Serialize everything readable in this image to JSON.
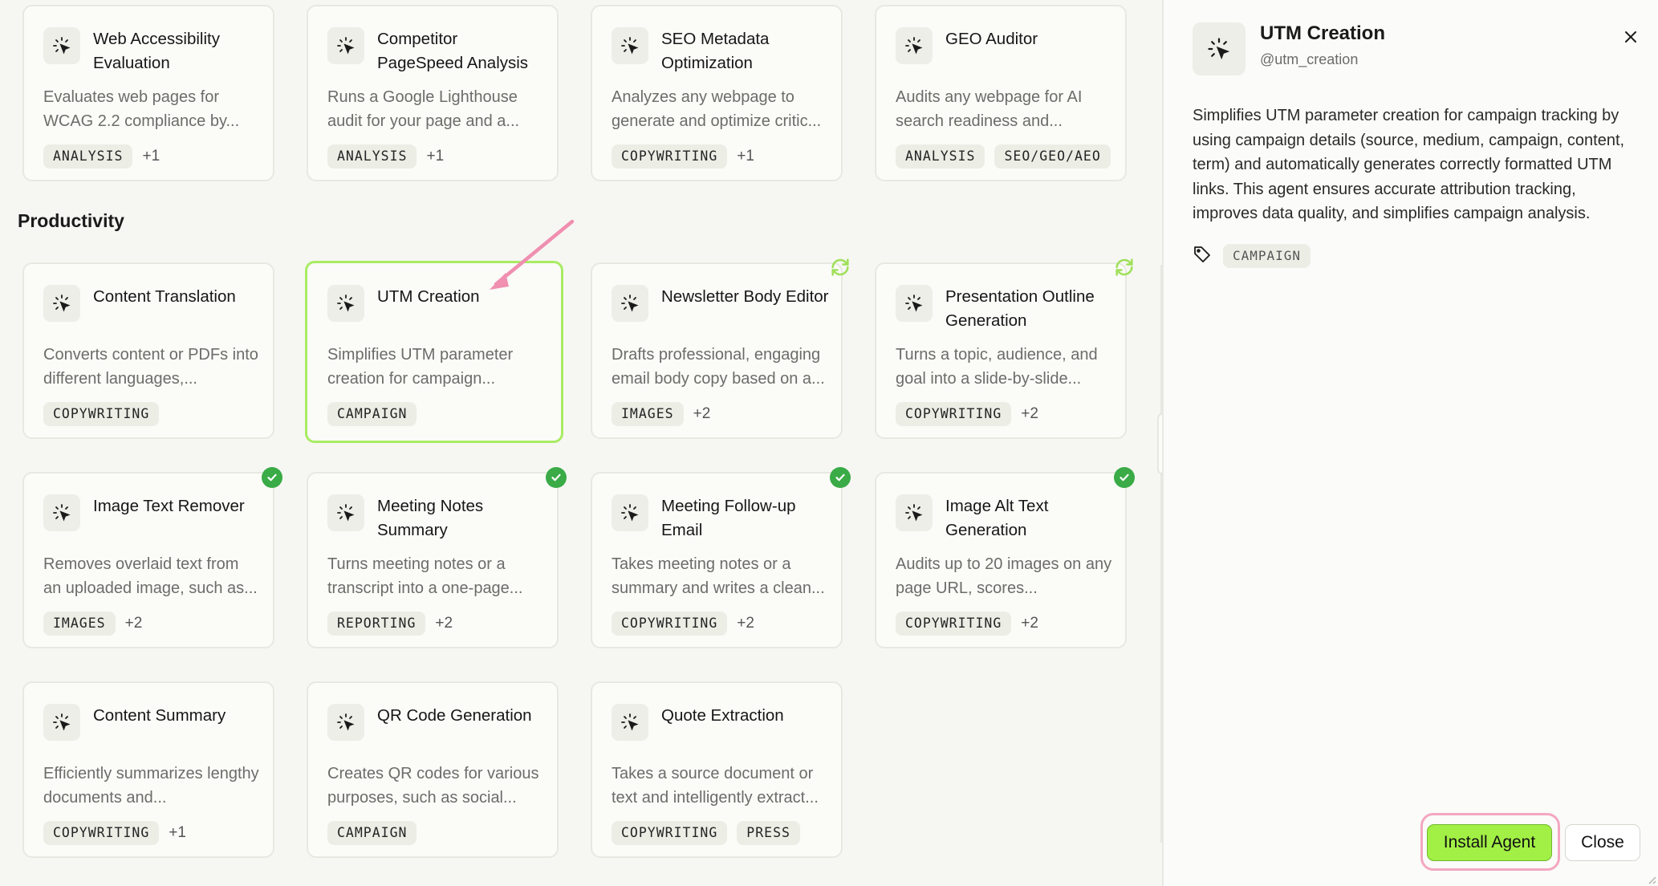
{
  "section": {
    "title": "Productivity"
  },
  "cards": [
    {
      "title": "Web Accessibility Evaluation",
      "desc": "Evaluates web pages for WCAG 2.2 compliance by...",
      "tags": [
        "ANALYSIS"
      ],
      "more": "+1"
    },
    {
      "title": "Competitor PageSpeed Analysis",
      "desc": "Runs a Google Lighthouse audit for your page and a...",
      "tags": [
        "ANALYSIS"
      ],
      "more": "+1"
    },
    {
      "title": "SEO Metadata Optimization",
      "desc": "Analyzes any webpage to generate and optimize critic...",
      "tags": [
        "COPYWRITING"
      ],
      "more": "+1"
    },
    {
      "title": "GEO Auditor",
      "desc": "Audits any webpage for AI search readiness and...",
      "tags": [
        "ANALYSIS",
        "SEO/GEO/AEO"
      ],
      "more": ""
    },
    {
      "title": "Content Translation",
      "desc": "Converts content or PDFs into different languages,...",
      "tags": [
        "COPYWRITING"
      ],
      "more": ""
    },
    {
      "title": "UTM Creation",
      "desc": "Simplifies UTM parameter creation for campaign...",
      "tags": [
        "CAMPAIGN"
      ],
      "more": ""
    },
    {
      "title": "Newsletter Body Editor",
      "desc": "Drafts professional, engaging email body copy based on a...",
      "tags": [
        "IMAGES"
      ],
      "more": "+2"
    },
    {
      "title": "Presentation Outline Generation",
      "desc": "Turns a topic, audience, and goal into a slide-by-slide...",
      "tags": [
        "COPYWRITING"
      ],
      "more": "+2"
    },
    {
      "title": "Image Text Remover",
      "desc": "Removes overlaid text from an uploaded image, such as...",
      "tags": [
        "IMAGES"
      ],
      "more": "+2"
    },
    {
      "title": "Meeting Notes Summary",
      "desc": "Turns meeting notes or a transcript into a one-page...",
      "tags": [
        "REPORTING"
      ],
      "more": "+2"
    },
    {
      "title": "Meeting Follow-up Email",
      "desc": "Takes meeting notes or a summary and writes a clean...",
      "tags": [
        "COPYWRITING"
      ],
      "more": "+2"
    },
    {
      "title": "Image Alt Text Generation",
      "desc": "Audits up to 20 images on any page URL, scores...",
      "tags": [
        "COPYWRITING"
      ],
      "more": "+2"
    },
    {
      "title": "Content Summary",
      "desc": "Efficiently summarizes lengthy documents and...",
      "tags": [
        "COPYWRITING"
      ],
      "more": "+1"
    },
    {
      "title": "QR Code Generation",
      "desc": "Creates QR codes for various purposes, such as social...",
      "tags": [
        "CAMPAIGN"
      ],
      "more": ""
    },
    {
      "title": "Quote Extraction",
      "desc": "Takes a source document or text and intelligently extract...",
      "tags": [
        "COPYWRITING",
        "PRESS"
      ],
      "more": ""
    }
  ],
  "panel": {
    "title": "UTM Creation",
    "handle": "@utm_creation",
    "description": "Simplifies UTM parameter creation for campaign tracking by using campaign details (source, medium, campaign, content, term) and automatically generates correctly formatted UTM links. This agent ensures accurate attribution tracking, improves data quality, and simplifies campaign analysis.",
    "tags": [
      "CAMPAIGN"
    ],
    "install_label": "Install Agent",
    "close_label": "Close"
  },
  "icons": {
    "agent": "cursor-click-icon",
    "installed": "check-circle-icon",
    "update": "sync-icon",
    "tag": "tag-icon",
    "close": "close-icon"
  },
  "colors": {
    "accent_green": "#a2f045",
    "selected_border": "#a8ec63",
    "installed_badge": "#3aab46",
    "annotation_pink": "#f08fb0"
  }
}
